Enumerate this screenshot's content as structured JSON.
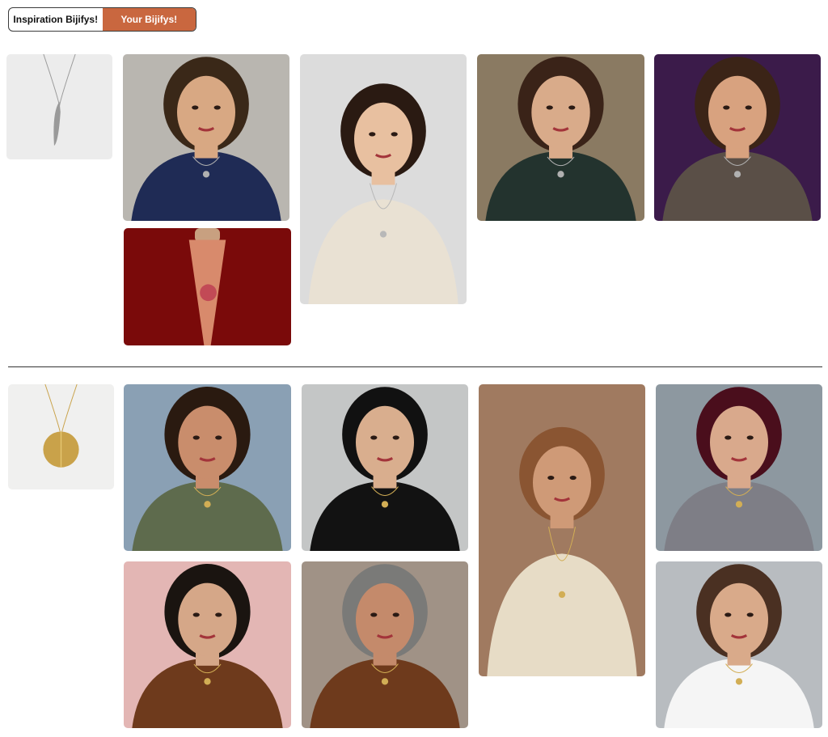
{
  "tabs": [
    {
      "label": "Inspiration Bijifys!",
      "active": false
    },
    {
      "label": "Your Bijifys!",
      "active": true
    }
  ],
  "colors": {
    "accent": "#c9673f",
    "divider": "#333333"
  },
  "gallery_top": [
    {
      "name": "silver-wing-necklace-product",
      "subject": "product",
      "bg": "#ececec",
      "metal": "#9a9a9a",
      "pendant": "wing"
    },
    {
      "name": "woman-navy-dress-wing-necklace",
      "subject": "portrait",
      "bg": "#b9b6b0",
      "skin": "#d8a883",
      "hair": "#3a2818",
      "outfit": "#1f2b55",
      "metal": "#b0b0b0"
    },
    {
      "name": "red-background-closeup",
      "subject": "closeup",
      "bg": "#7a0a0a",
      "accent": "#c24a56"
    },
    {
      "name": "woman-red-lips-cream-sweater",
      "subject": "portrait",
      "bg": "#dcdcdc",
      "skin": "#e8c0a0",
      "hair": "#2a1a12",
      "outfit": "#e9e1d3",
      "metal": "#b8b8b8"
    },
    {
      "name": "woman-rainy-window-green-top",
      "subject": "portrait",
      "bg": "#8a7a62",
      "skin": "#d9ab8a",
      "hair": "#3a2318",
      "outfit": "#23332e",
      "metal": "#b0b0b0"
    },
    {
      "name": "woman-purple-background-plaid",
      "subject": "portrait",
      "bg": "#3b1b4a",
      "skin": "#d8a27f",
      "hair": "#3b2417",
      "outfit": "#5a4f47",
      "metal": "#b0b0b0"
    }
  ],
  "gallery_bottom": [
    {
      "name": "gold-coin-necklace-product",
      "subject": "product",
      "bg": "#f0f0ef",
      "metal": "#c9a24a",
      "pendant": "coin"
    },
    {
      "name": "woman-curly-hair-olive-shirt",
      "subject": "portrait",
      "bg": "#8aa0b4",
      "skin": "#c98d6c",
      "hair": "#2a1a10",
      "outfit": "#5e6b4d",
      "metal": "#d2ae55"
    },
    {
      "name": "woman-black-offshoulder",
      "subject": "portrait",
      "bg": "#c4c6c6",
      "skin": "#d9ae8e",
      "hair": "#111111",
      "outfit": "#121212",
      "metal": "#d2ae55"
    },
    {
      "name": "woman-crochet-top-gold-coin",
      "subject": "portrait",
      "bg": "#a07a60",
      "skin": "#cf9a77",
      "hair": "#8a5532",
      "outfit": "#e7dcc6",
      "metal": "#d2ae55"
    },
    {
      "name": "woman-burgundy-hair-sequin",
      "subject": "portrait",
      "bg": "#8d98a0",
      "skin": "#d9a98c",
      "hair": "#4a0e1c",
      "outfit": "#7e7e86",
      "metal": "#d2ae55"
    },
    {
      "name": "woman-pink-background-brown-shirt",
      "subject": "portrait",
      "bg": "#e3b6b4",
      "skin": "#d5a788",
      "hair": "#1a1410",
      "outfit": "#6e3a1c",
      "metal": "#d2ae55"
    },
    {
      "name": "woman-short-gray-hair-brown-shirt",
      "subject": "portrait",
      "bg": "#a09286",
      "skin": "#c48a6b",
      "hair": "#7a7a78",
      "outfit": "#6e3a1c",
      "metal": "#d2ae55"
    },
    {
      "name": "woman-white-top-city-rooftop",
      "subject": "portrait",
      "bg": "#b8bcc0",
      "skin": "#d9aa8a",
      "hair": "#4a3022",
      "outfit": "#f5f5f5",
      "metal": "#d2ae55"
    }
  ]
}
